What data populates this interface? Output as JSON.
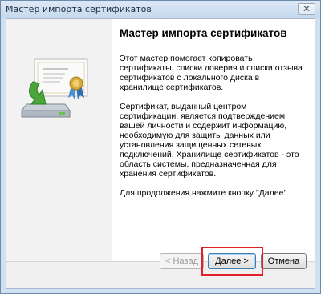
{
  "window": {
    "title": "Мастер импорта сертификатов",
    "close_glyph": "✕"
  },
  "wizard": {
    "icon": "certificate-import-icon",
    "heading": "Мастер импорта сертификатов",
    "paragraphs": [
      "Этот мастер помогает копировать сертификаты, списки доверия и списки отзыва сертификатов с локального диска в хранилище сертификатов.",
      "Сертификат, выданный центром сертификации, является подтверждением вашей личности и содержит информацию, необходимую для защиты данных или установления защищенных сетевых подключений. Хранилище сертификатов - это область системы, предназначенная для хранения сертификатов.",
      "Для продолжения нажмите кнопку \"Далее\"."
    ]
  },
  "buttons": {
    "back": "< Назад",
    "next": "Далее >",
    "cancel": "Отмена"
  },
  "colors": {
    "highlight": "#e0202a",
    "title_bar": "#cfe0f2"
  }
}
